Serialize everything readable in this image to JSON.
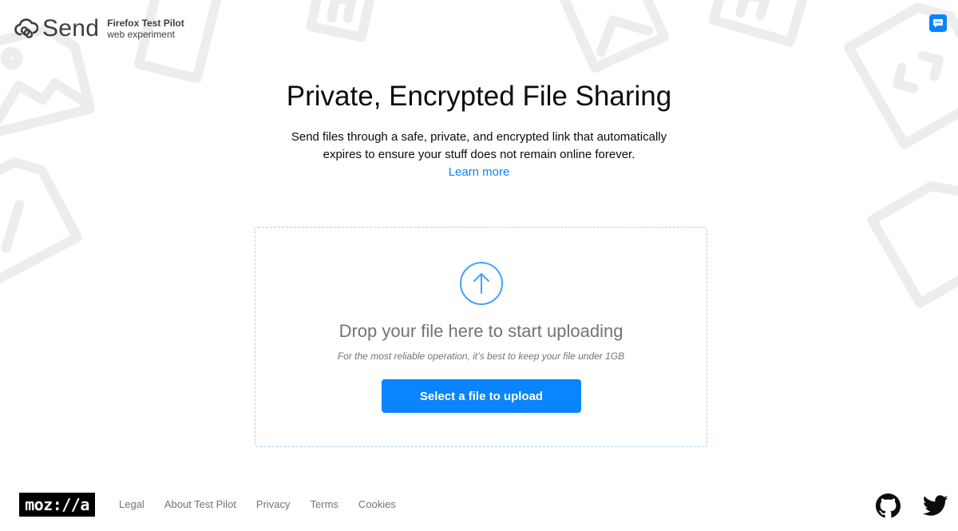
{
  "header": {
    "app_name": "Send",
    "test_pilot_title": "Firefox Test Pilot",
    "test_pilot_subtitle": "web experiment",
    "feedback_icon": "chat-bubble-icon"
  },
  "main": {
    "title": "Private, Encrypted File Sharing",
    "intro": "Send files through a safe, private, and encrypted link that automatically expires to ensure your stuff does not remain online forever.",
    "learn_more": "Learn more"
  },
  "upload": {
    "icon": "upload-arrow-icon",
    "drop_title": "Drop your file here to start uploading",
    "drop_note": "For the most reliable operation, it’s best to keep your file under 1GB",
    "button_label": "Select a file to upload"
  },
  "footer": {
    "mozilla_logo": "moz://a",
    "links": [
      "Legal",
      "About Test Pilot",
      "Privacy",
      "Terms",
      "Cookies"
    ],
    "social_icons": [
      "github-icon",
      "twitter-icon"
    ]
  },
  "colors": {
    "accent": "#0a84ff",
    "dropzone_border": "#a4d4f6",
    "muted_text": "#737373",
    "background_icons": "#ededf0"
  }
}
